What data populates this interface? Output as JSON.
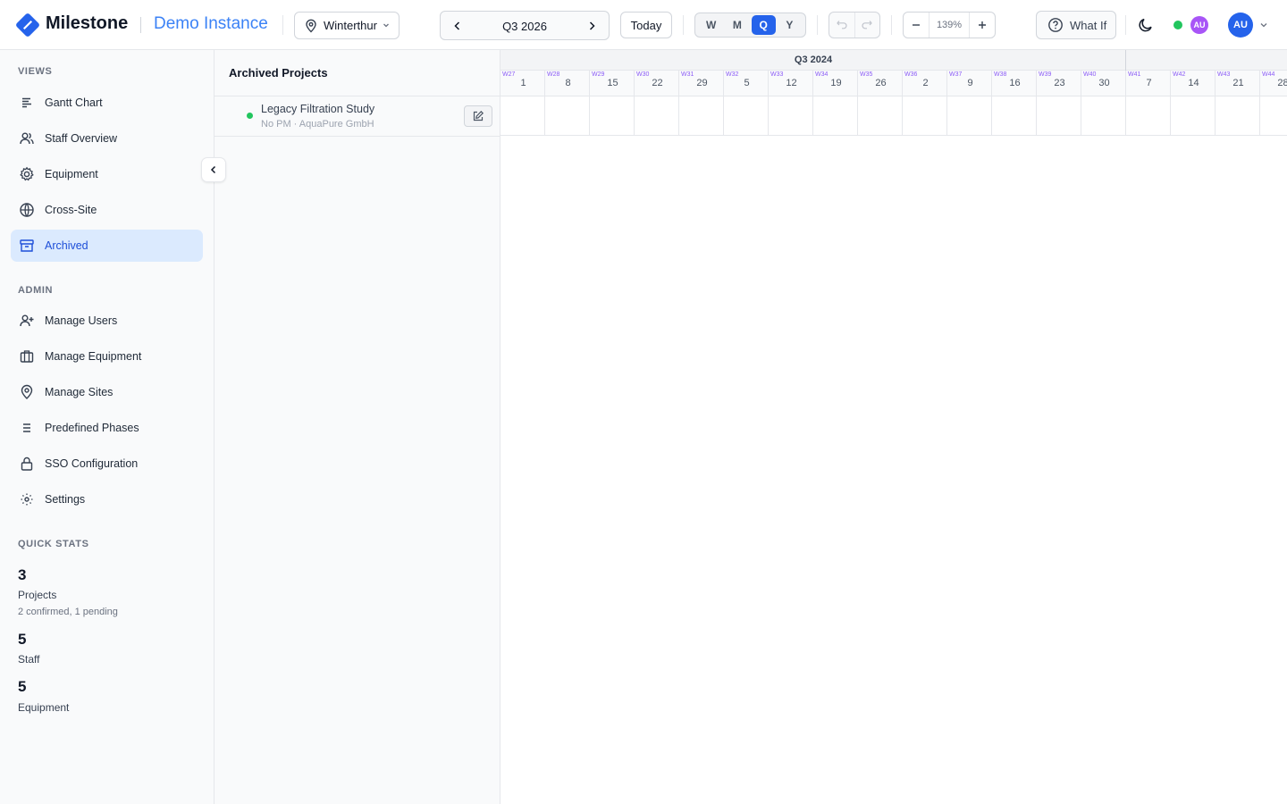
{
  "app": {
    "brand": "Milestone",
    "instance": "Demo Instance",
    "accent": "#2563eb"
  },
  "toolbar": {
    "site": "Winterthur",
    "period": "Q3 2026",
    "today": "Today",
    "scales": [
      "W",
      "M",
      "Q",
      "Y"
    ],
    "active_scale": "Q",
    "zoom": "139%",
    "what_if": "What If",
    "mini_avatar": "AU",
    "user_avatar": "AU",
    "online_status_color": "#22c55e"
  },
  "sidebar": {
    "views_title": "VIEWS",
    "views": [
      {
        "label": "Gantt Chart",
        "icon": "gantt-icon"
      },
      {
        "label": "Staff Overview",
        "icon": "users-icon"
      },
      {
        "label": "Equipment",
        "icon": "gear-icon"
      },
      {
        "label": "Cross-Site",
        "icon": "globe-icon"
      },
      {
        "label": "Archived",
        "icon": "archive-icon",
        "active": true
      }
    ],
    "admin_title": "ADMIN",
    "admin": [
      {
        "label": "Manage Users",
        "icon": "user-plus-icon"
      },
      {
        "label": "Manage Equipment",
        "icon": "briefcase-icon"
      },
      {
        "label": "Manage Sites",
        "icon": "map-pin-icon"
      },
      {
        "label": "Predefined Phases",
        "icon": "list-icon"
      },
      {
        "label": "SSO Configuration",
        "icon": "lock-icon"
      },
      {
        "label": "Settings",
        "icon": "settings-icon"
      }
    ],
    "stats_title": "QUICK STATS",
    "stats": [
      {
        "value": "3",
        "label": "Projects",
        "sub": "2 confirmed, 1 pending"
      },
      {
        "value": "5",
        "label": "Staff"
      },
      {
        "value": "5",
        "label": "Equipment"
      }
    ]
  },
  "project_list": {
    "title": "Archived Projects",
    "projects": [
      {
        "name": "Legacy Filtration Study",
        "meta": "No PM · AquaPure GmbH",
        "status_color": "#22c55e"
      }
    ]
  },
  "timeline": {
    "quarter": "Q3 2024",
    "weeks": [
      {
        "week": "W27",
        "day": "1"
      },
      {
        "week": "W28",
        "day": "8"
      },
      {
        "week": "W29",
        "day": "15"
      },
      {
        "week": "W30",
        "day": "22"
      },
      {
        "week": "W31",
        "day": "29"
      },
      {
        "week": "W32",
        "day": "5"
      },
      {
        "week": "W33",
        "day": "12"
      },
      {
        "week": "W34",
        "day": "19"
      },
      {
        "week": "W35",
        "day": "26"
      },
      {
        "week": "W36",
        "day": "2"
      },
      {
        "week": "W37",
        "day": "9"
      },
      {
        "week": "W38",
        "day": "16"
      },
      {
        "week": "W39",
        "day": "23"
      },
      {
        "week": "W40",
        "day": "30"
      },
      {
        "week": "W41",
        "day": "7"
      },
      {
        "week": "W42",
        "day": "14"
      },
      {
        "week": "W43",
        "day": "21"
      },
      {
        "week": "W44",
        "day": "28"
      }
    ]
  }
}
